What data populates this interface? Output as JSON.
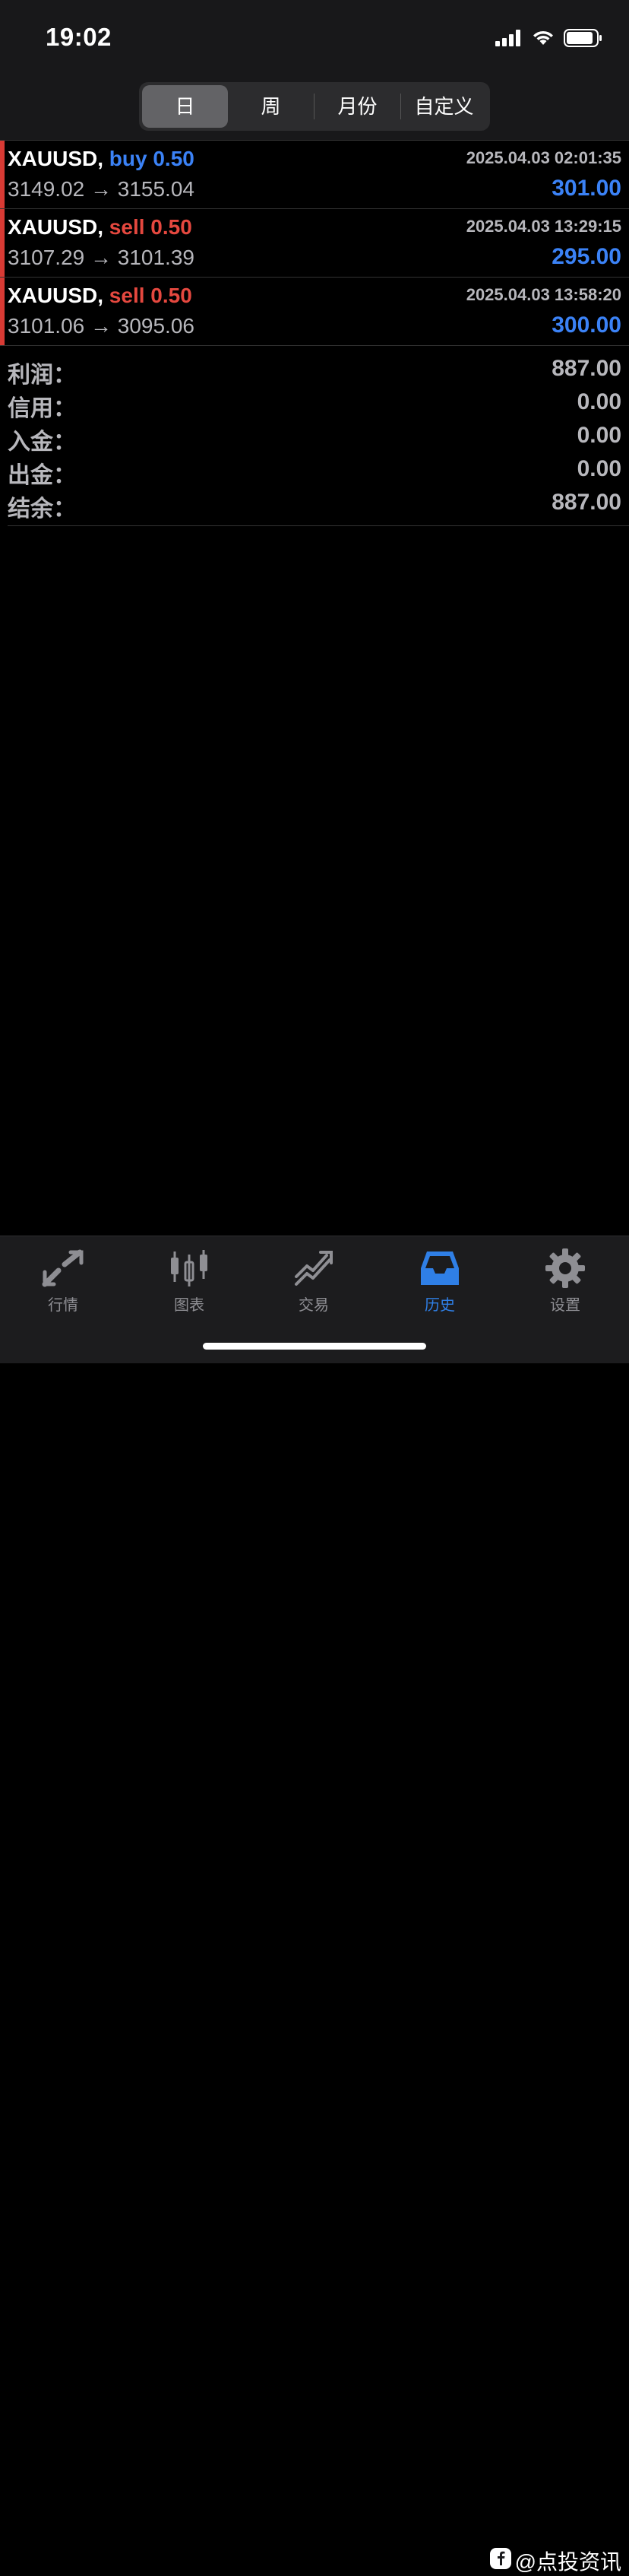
{
  "status_bar": {
    "time": "19:02"
  },
  "segments": [
    {
      "label": "日",
      "active": true
    },
    {
      "label": "周",
      "active": false
    },
    {
      "label": "月份",
      "active": false
    },
    {
      "label": "自定义",
      "active": false
    }
  ],
  "deals": [
    {
      "symbol": "XAUUSD",
      "separator": ",",
      "side": "buy",
      "volume": "0.50",
      "datetime": "2025.04.03 02:01:35",
      "prices": "3149.02 → 3155.04",
      "profit": "301.00"
    },
    {
      "symbol": "XAUUSD",
      "separator": ",",
      "side": "sell",
      "volume": "0.50",
      "datetime": "2025.04.03 13:29:15",
      "prices": "3107.29 → 3101.39",
      "profit": "295.00"
    },
    {
      "symbol": "XAUUSD",
      "separator": ",",
      "side": "sell",
      "volume": "0.50",
      "datetime": "2025.04.03 13:58:20",
      "prices": "3101.06 → 3095.06",
      "profit": "300.00"
    }
  ],
  "summary": [
    {
      "label": "利润：",
      "value": "887.00"
    },
    {
      "label": "信用：",
      "value": "0.00"
    },
    {
      "label": "入金：",
      "value": "0.00"
    },
    {
      "label": "出金：",
      "value": "0.00"
    },
    {
      "label": "结余：",
      "value": "887.00"
    }
  ],
  "tabs": [
    {
      "label": "行情",
      "icon": "quotes-icon",
      "active": false
    },
    {
      "label": "图表",
      "icon": "candlestick-chart-icon",
      "active": false
    },
    {
      "label": "交易",
      "icon": "trade-icon",
      "active": false
    },
    {
      "label": "历史",
      "icon": "history-inbox-icon",
      "active": true
    },
    {
      "label": "设置",
      "icon": "gear-icon",
      "active": false
    }
  ],
  "watermark": {
    "text": "@点投资讯"
  },
  "colors": {
    "buy": "#3b82f6",
    "sell": "#e5483f",
    "profit": "#3b82f6",
    "accent": "#2f7fe6",
    "side_bar": "#d83a34"
  }
}
